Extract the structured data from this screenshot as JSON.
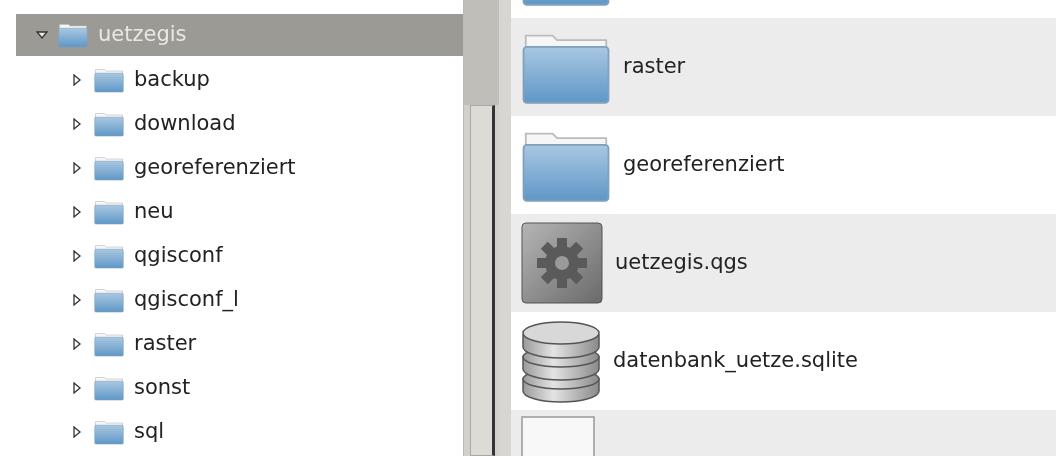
{
  "tree": {
    "label": "uetzegis",
    "expanded": true,
    "selected": true,
    "children": [
      {
        "label": "backup",
        "expanded": false,
        "selected": false
      },
      {
        "label": "download",
        "expanded": false,
        "selected": false
      },
      {
        "label": "georeferenziert",
        "expanded": false,
        "selected": false
      },
      {
        "label": "neu",
        "expanded": false,
        "selected": false
      },
      {
        "label": "qgisconf",
        "expanded": false,
        "selected": false
      },
      {
        "label": "qgisconf_l",
        "expanded": false,
        "selected": false
      },
      {
        "label": "raster",
        "expanded": false,
        "selected": false
      },
      {
        "label": "sonst",
        "expanded": false,
        "selected": false
      },
      {
        "label": "sql",
        "expanded": false,
        "selected": false
      }
    ]
  },
  "files": [
    {
      "kind": "folder"
    },
    {
      "kind": "folder",
      "name": "raster"
    },
    {
      "kind": "folder",
      "name": "georeferenziert"
    },
    {
      "kind": "project",
      "name": "uetzegis.qgs"
    },
    {
      "kind": "database",
      "name": "datenbank_uetze.sqlite"
    },
    {
      "kind": "document"
    }
  ]
}
